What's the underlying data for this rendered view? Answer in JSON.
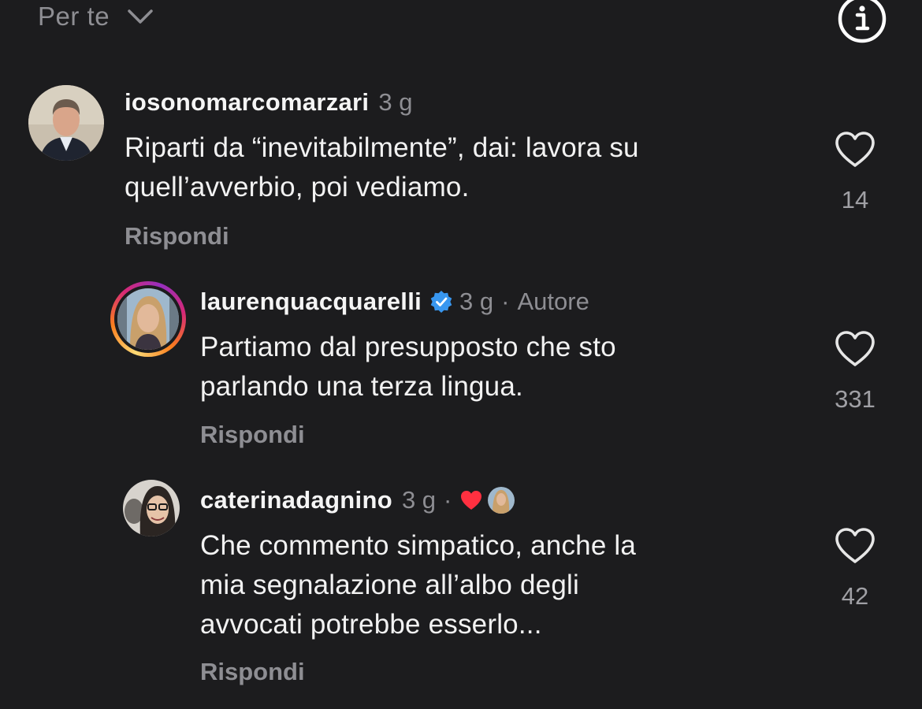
{
  "header": {
    "sort_label": "Per te"
  },
  "comments": [
    {
      "username": "iosonomarcomarzari",
      "time": "3 g",
      "lines": [
        "Riparti da “inevitabilmente”, dai: lavora su",
        "quell’avverbio, poi vediamo."
      ],
      "reply_label": "Rispondi",
      "likes": "14"
    },
    {
      "username": "laurenquacquarelli",
      "time": "3 g",
      "author_label": "Autore",
      "dot": "·",
      "lines": [
        "Partiamo dal presupposto che sto",
        "parlando una terza lingua."
      ],
      "reply_label": "Rispondi",
      "likes": "331"
    },
    {
      "username": "caterinadagnino",
      "time": "3 g",
      "dot": "·",
      "lines": [
        "Che commento simpatico, anche la",
        "mia segnalazione all’albo degli",
        "avvocati potrebbe esserlo..."
      ],
      "reply_label": "Rispondi",
      "likes": "42"
    }
  ],
  "icons": {
    "sort": "chevron-down-icon",
    "info": "info-icon",
    "like": "heart-icon",
    "verified": "verified-badge-icon",
    "creator_liked": "red-heart-icon"
  },
  "colors": {
    "background": "#1c1c1e",
    "text_primary": "#f2f2f2",
    "text_secondary": "#8e8e93",
    "verified_blue": "#3897f0",
    "liked_red": "#ff3040"
  }
}
